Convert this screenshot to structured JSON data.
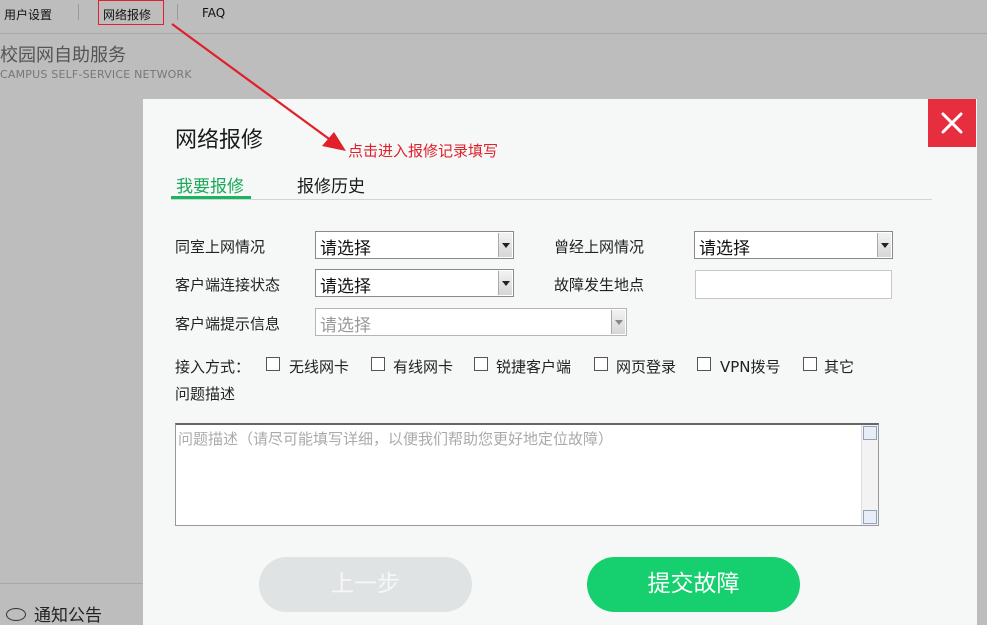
{
  "nav": {
    "items": [
      {
        "label": "用户设置"
      },
      {
        "label": "网络报修"
      },
      {
        "label": "FAQ"
      }
    ]
  },
  "brand": {
    "title": "校园网自助服务",
    "subtitle": "CAMPUS  SELF-SERVICE NETWORK"
  },
  "sidebar": {
    "notice_label": "通知公告"
  },
  "modal": {
    "title": "网络报修",
    "tabs": [
      {
        "label": "我要报修",
        "active": true
      },
      {
        "label": "报修历史",
        "active": false
      }
    ],
    "fields": {
      "roommate_label": "同室上网情况",
      "roommate_value": "请选择",
      "past_label": "曾经上网情况",
      "past_value": "请选择",
      "client_status_label": "客户端连接状态",
      "client_status_value": "请选择",
      "fault_location_label": "故障发生地点",
      "fault_location_value": "",
      "client_msg_label": "客户端提示信息",
      "client_msg_value": "请选择"
    },
    "access": {
      "label": "接入方式：",
      "options": [
        {
          "label": "无线网卡",
          "checked": false
        },
        {
          "label": "有线网卡",
          "checked": false
        },
        {
          "label": "锐捷客户端",
          "checked": false
        },
        {
          "label": "网页登录",
          "checked": false
        },
        {
          "label": "VPN拨号",
          "checked": false
        },
        {
          "label": "其它",
          "checked": false
        }
      ]
    },
    "description": {
      "label": "问题描述",
      "placeholder": "问题描述（请尽可能填写详细，以便我们帮助您更好地定位故障）"
    },
    "buttons": {
      "prev": "上一步",
      "submit": "提交故障"
    }
  },
  "annotation": {
    "text": "点击进入报修记录填写"
  },
  "colors": {
    "accent_green": "#16d070",
    "tab_green": "#1ca85a",
    "close_red": "#e72e3f",
    "annotation_red": "#e0202a"
  }
}
